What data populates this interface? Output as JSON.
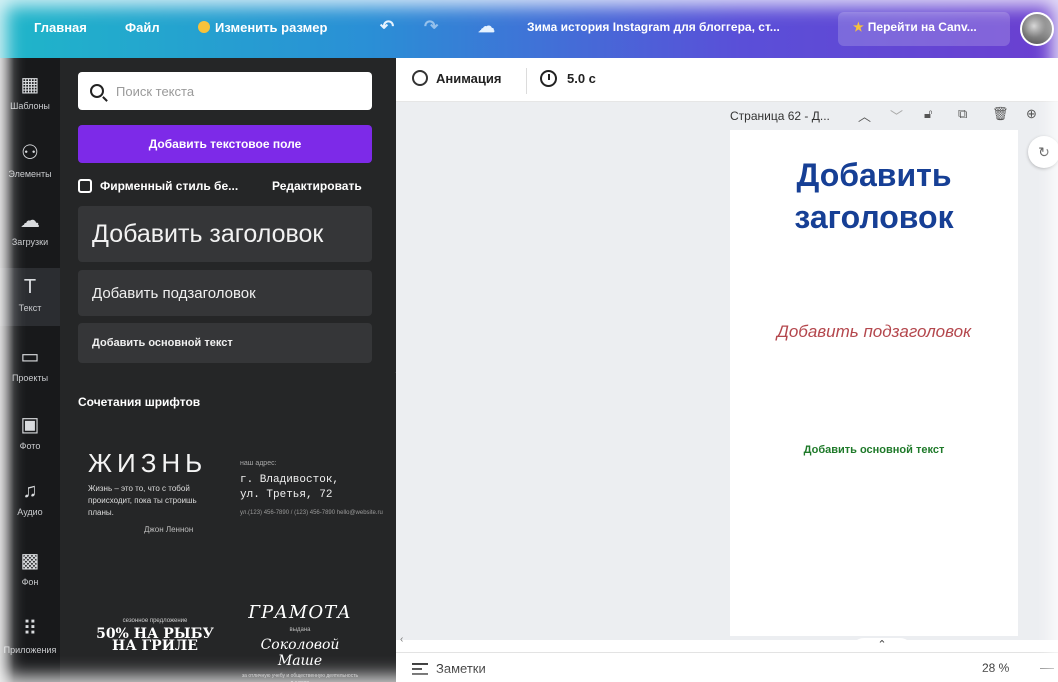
{
  "topbar": {
    "home": "Главная",
    "file": "Файл",
    "resize": "Изменить размер",
    "undo_icon": "undo-icon",
    "redo_icon": "redo-icon",
    "cloud_icon": "cloud-check-icon",
    "doc_title": "Зима история Instagram для блоггера, ст...",
    "upgrade": "Перейти на Canv...",
    "colors": {
      "accent": "#7d2ae8",
      "gold": "#f7c23a"
    }
  },
  "rail": {
    "items": [
      {
        "label": "Шаблоны",
        "icon": "templates-icon",
        "glyph": "▦"
      },
      {
        "label": "Элементы",
        "icon": "elements-icon",
        "glyph": "⚇"
      },
      {
        "label": "Загрузки",
        "icon": "uploads-icon",
        "glyph": "☁"
      },
      {
        "label": "Текст",
        "icon": "text-icon",
        "glyph": "T"
      },
      {
        "label": "Проекты",
        "icon": "folder-icon",
        "glyph": "▭"
      },
      {
        "label": "Фото",
        "icon": "photo-icon",
        "glyph": "▣"
      },
      {
        "label": "Аудио",
        "icon": "audio-icon",
        "glyph": "♫"
      },
      {
        "label": "Фон",
        "icon": "background-icon",
        "glyph": "▩"
      },
      {
        "label": "Приложения",
        "icon": "apps-icon",
        "glyph": "⠿"
      }
    ]
  },
  "panel": {
    "search_placeholder": "Поиск текста",
    "add_text_button": "Добавить текстовое поле",
    "brand_label": "Фирменный стиль бе...",
    "brand_edit": "Редактировать",
    "heading_option": "Добавить заголовок",
    "subheading_option": "Добавить подзаголовок",
    "body_option": "Добавить основной текст",
    "combos_title": "Сочетания шрифтов",
    "combo1": {
      "big": "ЖИЗНЬ",
      "small": "Жизнь – это то, что с тобой происходит, пока ты строишь планы.",
      "author": "Джон Леннон"
    },
    "combo2": {
      "tiny": "наш адрес:",
      "address_line1": "г. Владивосток,",
      "address_line2": "ул. Третья, 72",
      "tiny2": "ул.(123) 456-7890 / (123) 456-7890 hello@website.ru"
    },
    "combo3": {
      "tiny": "сезонное предложение",
      "big": "50% НА РЫБУ НА ГРИЛЕ"
    },
    "combo4": {
      "gram": "ГРАМОТА",
      "tiny": "выдана",
      "name": "Соколовой Маше",
      "tiny2": "за отличную учебу и общественную деятельность в школе"
    }
  },
  "toolbar": {
    "animation": "Анимация",
    "duration": "5.0 с"
  },
  "page_bar": {
    "label": "Страница 62 - Д..."
  },
  "canvas": {
    "heading_line1": "Добавить",
    "heading_line2": "заголовок",
    "subheading": "Добавить подзаголовок",
    "body": "Добавить основной текст",
    "colors": {
      "heading": "#163f95",
      "subheading": "#b4474d",
      "body": "#1f7a2a"
    }
  },
  "bottombar": {
    "notes": "Заметки",
    "zoom": "28 %"
  }
}
